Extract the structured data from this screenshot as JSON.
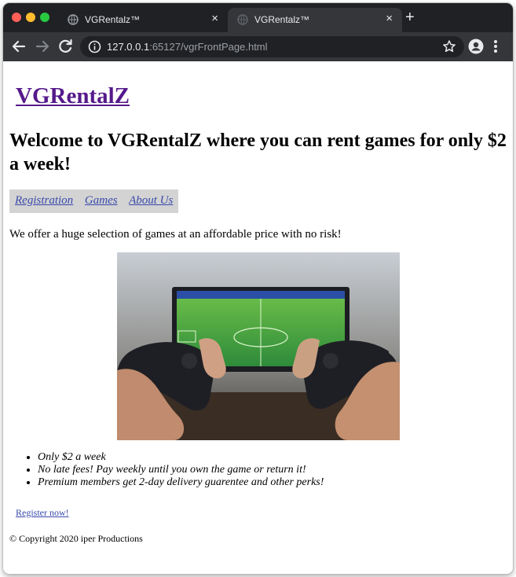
{
  "browser": {
    "tabs": [
      {
        "title": "VGRentalz™",
        "close": "×",
        "active": false
      },
      {
        "title": "VGRentalz™",
        "close": "×",
        "active": true
      }
    ],
    "new_tab": "+",
    "url_host": "127.0.0.1",
    "url_rest": ":65127/vgrFrontPage.html",
    "icons": [
      "back-arrow-icon",
      "forward-arrow-icon",
      "reload-icon",
      "info-icon",
      "star-icon",
      "profile-icon",
      "menu-icon",
      "globe-favicon-icon",
      "close-icon",
      "plus-icon"
    ]
  },
  "page": {
    "brand": "VGRentalZ",
    "welcome": "Welcome to VGRentalZ where you can rent games for only $2 a week!",
    "nav": [
      "Registration",
      "Games",
      "About Us"
    ],
    "intro": "We offer a huge selection of games at an affordable price with no risk!",
    "perks": [
      "Only $2 a week",
      "No late fees! Pay weekly until you own the game or return it!",
      "Premium members get 2-day delivery guarentee and other perks!"
    ],
    "register_link": "Register now!",
    "copyright": "© Copyright 2020 iper Productions"
  },
  "colors": {
    "tab_strip": "#202124",
    "toolbar": "#35363a",
    "visited_link": "#551a8b",
    "link": "#3949ab",
    "nav_background": "#d3d3d3"
  }
}
